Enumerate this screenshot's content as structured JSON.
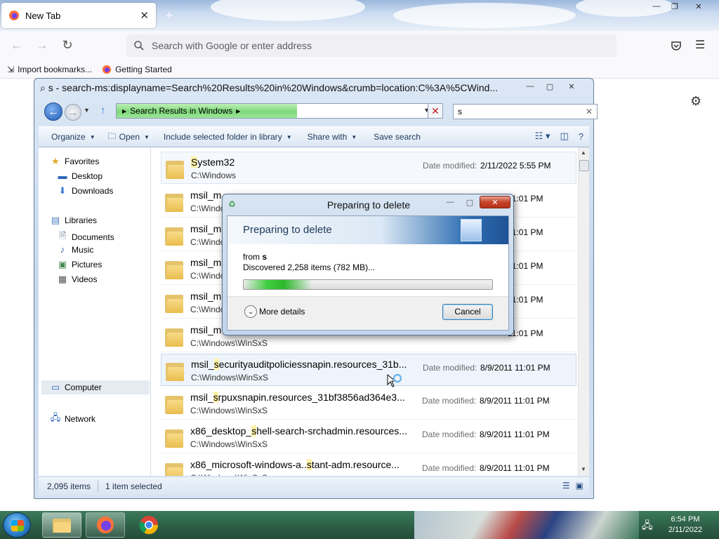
{
  "browser": {
    "tab_title": "New Tab",
    "tab_close": "✕",
    "new_tab": "+",
    "window_controls": {
      "minimize": "—",
      "restore": "❐",
      "close": "✕"
    },
    "url_placeholder": "Search with Google or enter address",
    "bookmarks": [
      {
        "label": "Import bookmarks...",
        "icon": "import-icon"
      },
      {
        "label": "Getting Started",
        "icon": "firefox-icon"
      }
    ]
  },
  "explorer": {
    "title": "s - search-ms:displayname=Search%20Results%20in%20Windows&crumb=location:C%3A%5CWind...",
    "address_crumb": "Search Results in Windows",
    "address_progress": 0.57,
    "search_value": "s",
    "toolbar": {
      "organize": "Organize",
      "open": "Open",
      "include": "Include selected folder in library",
      "share": "Share with",
      "save_search": "Save search"
    },
    "nav": {
      "favorites": "Favorites",
      "desktop": "Desktop",
      "downloads": "Downloads",
      "libraries": "Libraries",
      "documents": "Documents",
      "music": "Music",
      "pictures": "Pictures",
      "videos": "Videos",
      "computer": "Computer",
      "network": "Network"
    },
    "date_label": "Date modified:",
    "rows": [
      {
        "name_parts": [
          "",
          "S",
          "ystem32"
        ],
        "path": "C:\\Windows",
        "date": "2/11/2022 5:55 PM"
      },
      {
        "name_parts": [
          "msil_m",
          "",
          ""
        ],
        "path": "C:\\Windo",
        "date": "11:01 PM"
      },
      {
        "name_parts": [
          "msil_m",
          "",
          ""
        ],
        "path": "C:\\Windo",
        "date": "11:01 PM"
      },
      {
        "name_parts": [
          "msil_m",
          "",
          ""
        ],
        "path": "C:\\Windo",
        "date": "11:01 PM"
      },
      {
        "name_parts": [
          "msil_m",
          "",
          ""
        ],
        "path": "C:\\Windo",
        "date": "11:01 PM"
      },
      {
        "name_parts": [
          "msil_m",
          "",
          ""
        ],
        "path": "C:\\Windows\\WinSxS",
        "date": "11:01 PM"
      },
      {
        "name_parts": [
          "msil_",
          "s",
          "ecurityauditpoliciessnapin.resources_31b..."
        ],
        "path": "C:\\Windows\\WinSxS",
        "date": "8/9/2011 11:01 PM"
      },
      {
        "name_parts": [
          "msil_",
          "s",
          "rpuxsnapin.resources_31bf3856ad364e3..."
        ],
        "path": "C:\\Windows\\WinSxS",
        "date": "8/9/2011 11:01 PM"
      },
      {
        "name_parts": [
          "x86_desktop_",
          "s",
          "hell-search-srchadmin.resources..."
        ],
        "path": "C:\\Windows\\WinSxS",
        "date": "8/9/2011 11:01 PM"
      },
      {
        "name_parts": [
          "x86_microsoft-windows-a..",
          "s",
          "tant-adm.resource..."
        ],
        "path": "C:\\Windows\\WinSxS",
        "date": "8/9/2011 11:01 PM"
      }
    ],
    "status": {
      "items": "2,095 items",
      "selected": "1 item selected"
    }
  },
  "dialog": {
    "title": "Preparing to delete",
    "heading": "Preparing to delete",
    "from_label": "from",
    "from_value": "s",
    "discovered": "Discovered 2,258 items (782 MB)...",
    "progress": 0.27,
    "more_details": "More details",
    "cancel": "Cancel"
  },
  "taskbar": {
    "time": "6:54 PM",
    "date": "2/11/2022",
    "apps": [
      "windows-explorer",
      "firefox",
      "chrome"
    ]
  },
  "colors": {
    "win7_glass": "#c7d9ef",
    "progress_green": "#3fce3f",
    "taskbar": "#2e6147",
    "highlight": "#fff3a8"
  }
}
